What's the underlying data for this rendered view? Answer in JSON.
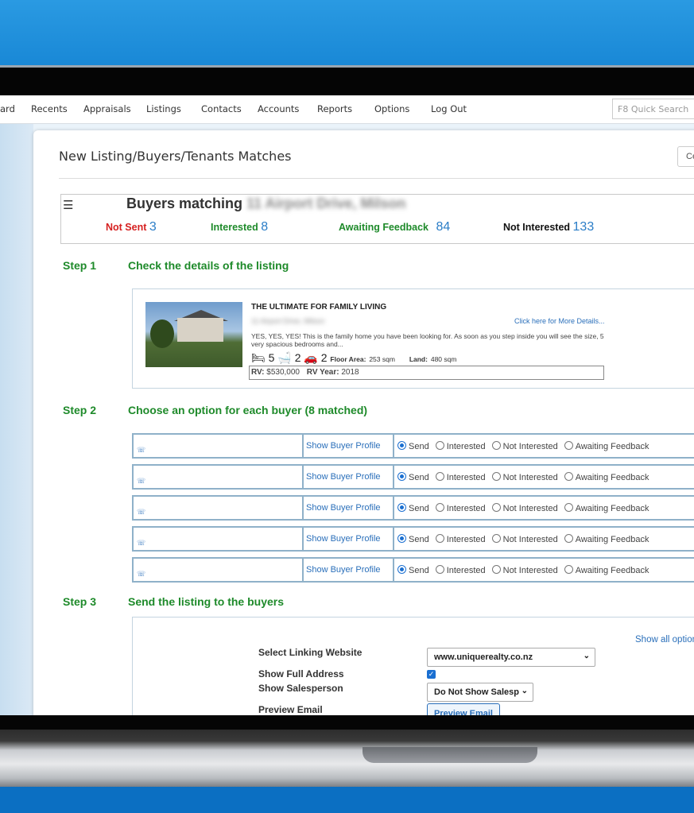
{
  "nav": {
    "items": [
      "ard",
      "Recents",
      "Appraisals",
      "Listings",
      "Contacts",
      "Accounts",
      "Reports",
      "Options",
      "Log Out"
    ],
    "search_placeholder": "F8 Quick Search"
  },
  "panel": {
    "title": "New Listing/Buyers/Tenants Matches",
    "close_label": "Ce"
  },
  "matches": {
    "heading": "Buyers matching",
    "address": "11 Airport Drive, Milson",
    "not_sent_label": "Not Sent",
    "not_sent_count": "3",
    "interested_label": "Interested",
    "interested_count": "8",
    "awaiting_label": "Awaiting Feedback",
    "awaiting_count": "84",
    "not_interested_label": "Not Interested",
    "not_interested_count": "133"
  },
  "steps": {
    "step1_label": "Step 1",
    "step1_text": "Check the details of the listing",
    "step2_label": "Step 2",
    "step2_text": "Choose an option for each buyer (8 matched)",
    "step3_label": "Step 3",
    "step3_text": "Send the listing to the buyers"
  },
  "listing": {
    "title": "THE ULTIMATE FOR FAMILY LIVING",
    "address": "11 Airport Drive, Milson",
    "more_link": "Click here for More Details...",
    "description": "YES, YES, YES! This is the family home you have been looking for. As soon as you step inside you will see the size, 5 very spacious bedrooms and...",
    "bedrooms": "5",
    "bathrooms": "2",
    "car_spaces": "2",
    "floor_area_label": "Floor Area:",
    "floor_area": "253 sqm",
    "land_label": "Land:",
    "land": "480 sqm",
    "rv_label": "RV:",
    "rv": "$530,000",
    "rv_year_label": "RV Year:",
    "rv_year": "2018"
  },
  "buyers": {
    "profile_link": "Show Buyer Profile",
    "options": [
      "Send",
      "Interested",
      "Not Interested",
      "Awaiting Feedback"
    ],
    "selected": "Send",
    "row_count": 5
  },
  "send": {
    "show_all": "Show all option",
    "website_label": "Select Linking Website",
    "website_value": "www.uniquerealty.co.nz",
    "full_address_label": "Show Full Address",
    "full_address_checked": true,
    "salesperson_label": "Show Salesperson",
    "salesperson_value": "Do Not Show Salesp",
    "preview_label": "Preview Email",
    "preview_button": "Preview Email"
  },
  "colors": {
    "accent_green": "#1e8a2a",
    "link_blue": "#2a6fba",
    "not_sent_red": "#d62020",
    "background_blue": "#0f7fd0"
  }
}
